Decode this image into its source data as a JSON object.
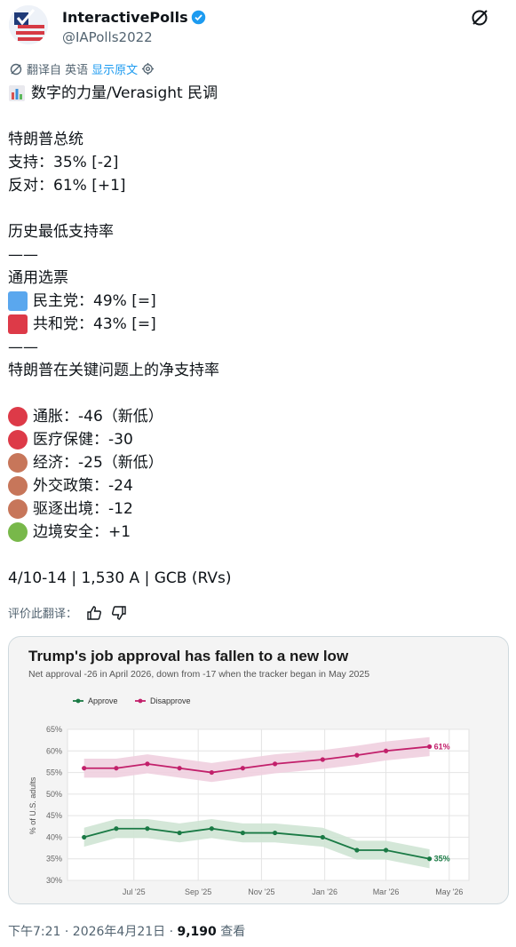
{
  "account": {
    "name": "InteractivePolls",
    "handle": "@IAPolls2022"
  },
  "translation": {
    "from_label": "翻译自 英语",
    "show_original": "显示原文"
  },
  "tweet_lines": [
    {
      "text": "数字的力量/Verasight 民调",
      "marker": "chart-emoji"
    },
    {
      "text": ""
    },
    {
      "text": "特朗普总统"
    },
    {
      "text": "支持：35% [-2]"
    },
    {
      "text": "反对：61% [+1]"
    },
    {
      "text": ""
    },
    {
      "text": "历史最低支持率"
    },
    {
      "text": "——"
    },
    {
      "text": "通用选票"
    },
    {
      "text": "民主党：49% [=]",
      "marker": "square",
      "color": "#5aa7ee"
    },
    {
      "text": "共和党：43% [=]",
      "marker": "square",
      "color": "#dd3a48"
    },
    {
      "text": "——"
    },
    {
      "text": "特朗普在关键问题上的净支持率"
    },
    {
      "text": ""
    },
    {
      "text": "通胀：-46（新低）",
      "marker": "circle",
      "color": "#dd3a48"
    },
    {
      "text": "医疗保健：-30",
      "marker": "circle",
      "color": "#dd3a48"
    },
    {
      "text": "经济：-25（新低）",
      "marker": "circle",
      "color": "#c7765a"
    },
    {
      "text": "外交政策：-24",
      "marker": "circle",
      "color": "#c7765a"
    },
    {
      "text": "驱逐出境：-12",
      "marker": "circle",
      "color": "#c7765a"
    },
    {
      "text": "边境安全：+1",
      "marker": "circle",
      "color": "#78b84a"
    },
    {
      "text": ""
    },
    {
      "text": "4/10-14 | 1,530 A | GCB (RVs)"
    }
  ],
  "rate_translation": "评价此翻译：",
  "footer": {
    "time": "下午7:21 · 2026年4月21日 · ",
    "views": "9,190",
    "views_label": " 查看"
  },
  "chart_data": {
    "type": "line",
    "title": "Trump's job approval has fallen to a new low",
    "subtitle": "Net approval -26 in April 2026, down from -17 when the tracker began in May 2025",
    "ylabel": "% of U.S. adults",
    "ylim": [
      30,
      65
    ],
    "yticks": [
      "30%",
      "35%",
      "40%",
      "45%",
      "50%",
      "55%",
      "60%",
      "65%"
    ],
    "xticks": [
      "Jul '25",
      "Sep '25",
      "Nov '25",
      "Jan '26",
      "Mar '26",
      "May '26"
    ],
    "grid": true,
    "legend_position": "top-left",
    "series": [
      {
        "name": "Approve",
        "color": "#1a7a45",
        "band": "#cfe4d4",
        "end_label": "35%",
        "points": [
          [
            "2025-05-14",
            40
          ],
          [
            "2025-06-14",
            42
          ],
          [
            "2025-07-14",
            42
          ],
          [
            "2025-08-14",
            41
          ],
          [
            "2025-09-14",
            42
          ],
          [
            "2025-10-14",
            41
          ],
          [
            "2025-11-14",
            41
          ],
          [
            "2025-12-30",
            40
          ],
          [
            "2026-02-01",
            37
          ],
          [
            "2026-03-01",
            37
          ],
          [
            "2026-04-12",
            35
          ]
        ]
      },
      {
        "name": "Disapprove",
        "color": "#c2206b",
        "band": "#f0cfdf",
        "end_label": "61%",
        "points": [
          [
            "2025-05-14",
            56
          ],
          [
            "2025-06-14",
            56
          ],
          [
            "2025-07-14",
            57
          ],
          [
            "2025-08-14",
            56
          ],
          [
            "2025-09-14",
            55
          ],
          [
            "2025-10-14",
            56
          ],
          [
            "2025-11-14",
            57
          ],
          [
            "2025-12-30",
            58
          ],
          [
            "2026-02-01",
            59
          ],
          [
            "2026-03-01",
            60
          ],
          [
            "2026-04-12",
            61
          ]
        ]
      }
    ]
  },
  "colors": {
    "link": "#1d9bf0",
    "muted": "#536471",
    "verified": "#1d9bf0"
  }
}
